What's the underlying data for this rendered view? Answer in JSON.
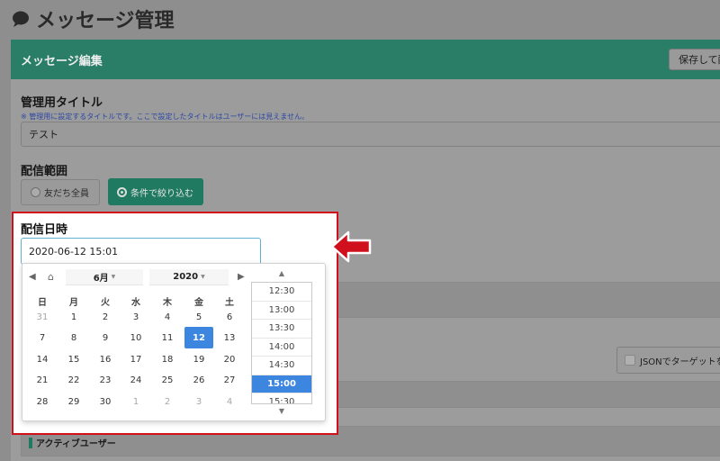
{
  "page": {
    "title": "メッセージ管理",
    "icon": "speech-bubble-icon"
  },
  "editor": {
    "header_title": "メッセージ編集",
    "save_button": "保存して配信"
  },
  "title_field": {
    "label": "管理用タイトル",
    "note": "※ 管理用に設定するタイトルです。ここで設定したタイトルはユーザーには見えません。",
    "value": "テスト"
  },
  "scope": {
    "label": "配信範囲",
    "option_all": "友だち全員",
    "option_filter": "条件で絞り込む",
    "selected": "条件で絞り込む"
  },
  "datetime": {
    "label": "配信日時",
    "value": "2020-06-12 15:01"
  },
  "picker": {
    "month": "6月",
    "year": "2020",
    "weekdays": [
      "日",
      "月",
      "火",
      "水",
      "木",
      "金",
      "土"
    ],
    "weeks": [
      [
        "31",
        "1",
        "2",
        "3",
        "4",
        "5",
        "6"
      ],
      [
        "7",
        "8",
        "9",
        "10",
        "11",
        "12",
        "13"
      ],
      [
        "14",
        "15",
        "16",
        "17",
        "18",
        "19",
        "20"
      ],
      [
        "21",
        "22",
        "23",
        "24",
        "25",
        "26",
        "27"
      ],
      [
        "28",
        "29",
        "30",
        "1",
        "2",
        "3",
        "4"
      ]
    ],
    "selected_day": "12",
    "times": [
      "12:30",
      "13:00",
      "13:30",
      "14:00",
      "14:30",
      "15:00",
      "15:30"
    ],
    "selected_time": "15:00"
  },
  "json_target": "JSONでターゲットを",
  "segment_label": "アクティブユーザー",
  "colors": {
    "header": "#2a7d67",
    "accent": "#3d86e0",
    "highlight": "#d0101c"
  }
}
